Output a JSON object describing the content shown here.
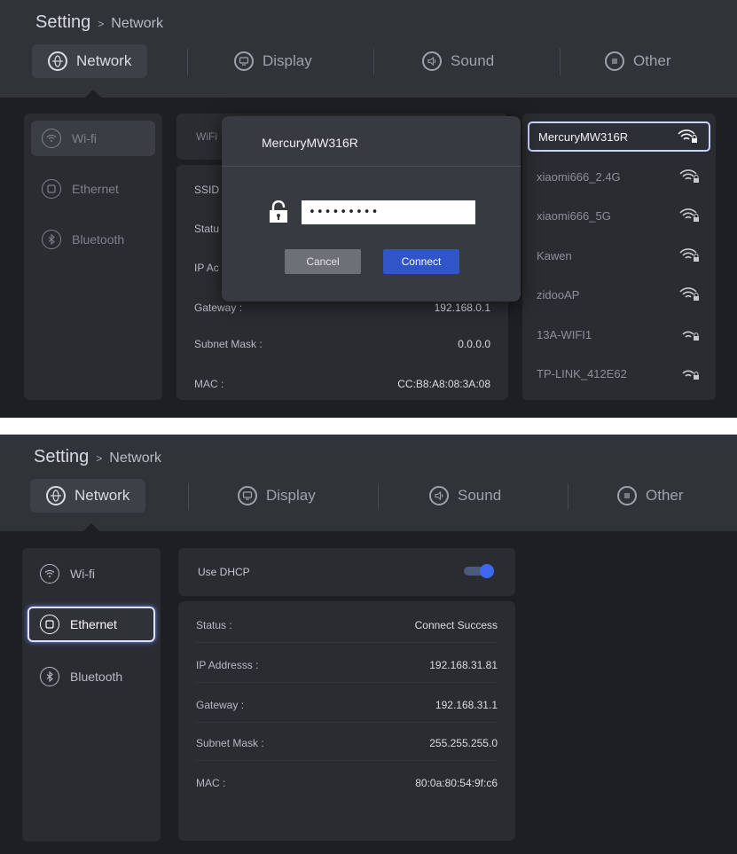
{
  "colors": {
    "background": "#1e1f23",
    "header": "#303338",
    "card": "#2a2c31",
    "accent": "#2f55c8",
    "toggle_on": "#3d68f2"
  },
  "screen1": {
    "breadcrumb": {
      "root": "Setting",
      "separator": ">",
      "current": "Network"
    },
    "tabs": [
      {
        "label": "Network",
        "icon": "globe-icon"
      },
      {
        "label": "Display",
        "icon": "display-icon"
      },
      {
        "label": "Sound",
        "icon": "speaker-icon"
      },
      {
        "label": "Other",
        "icon": "menu-icon"
      }
    ],
    "sidebar": [
      {
        "label": "Wi-fi",
        "icon": "wifi-icon"
      },
      {
        "label": "Ethernet",
        "icon": "ethernet-icon"
      },
      {
        "label": "Bluetooth",
        "icon": "bluetooth-icon"
      }
    ],
    "wifi_card_label": "WiFi",
    "info_labels": [
      "SSID",
      "Statu",
      "IP Ac",
      "Gateway :",
      "Subnet Mask :",
      "MAC :"
    ],
    "info_values": {
      "gateway": "192.168.0.1",
      "subnet": "0.0.0.0",
      "mac": "CC:B8:A8:08:3A:08"
    },
    "networks": [
      "MercuryMW316R",
      "xiaomi666_2.4G",
      "xiaomi666_5G",
      "Kawen",
      "zidooAP",
      "13A-WIFI1",
      "TP-LINK_412E62"
    ],
    "dialog": {
      "title": "MercuryMW316R",
      "password": "•••••••••",
      "cancel": "Cancel",
      "connect": "Connect"
    }
  },
  "screen2": {
    "breadcrumb": {
      "root": "Setting",
      "separator": ">",
      "current": "Network"
    },
    "tabs": [
      {
        "label": "Network",
        "icon": "globe-icon"
      },
      {
        "label": "Display",
        "icon": "display-icon"
      },
      {
        "label": "Sound",
        "icon": "speaker-icon"
      },
      {
        "label": "Other",
        "icon": "menu-icon"
      }
    ],
    "sidebar": [
      {
        "label": "Wi-fi",
        "icon": "wifi-icon"
      },
      {
        "label": "Ethernet",
        "icon": "ethernet-icon"
      },
      {
        "label": "Bluetooth",
        "icon": "bluetooth-icon"
      }
    ],
    "dhcp_label": "Use DHCP",
    "dhcp_enabled": true,
    "info": [
      {
        "label": "Status :",
        "value": "Connect Success"
      },
      {
        "label": "IP Addresss :",
        "value": "192.168.31.81"
      },
      {
        "label": "Gateway :",
        "value": "192.168.31.1"
      },
      {
        "label": "Subnet Mask :",
        "value": "255.255.255.0"
      },
      {
        "label": "MAC :",
        "value": "80:0a:80:54:9f:c6"
      }
    ]
  }
}
